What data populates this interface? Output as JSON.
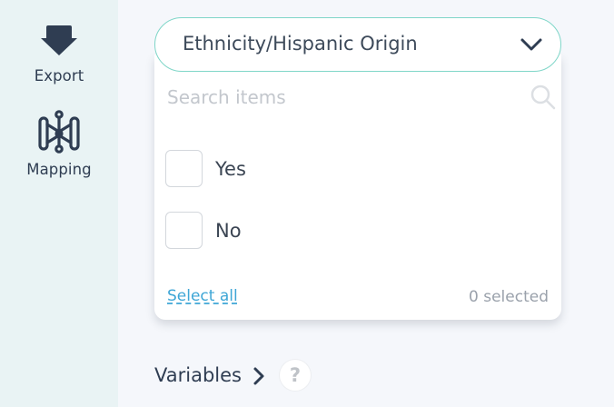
{
  "sidebar": {
    "export": {
      "label": "Export",
      "icon": "download-arrow-icon"
    },
    "mapping": {
      "label": "Mapping",
      "icon": "mapping-icon"
    }
  },
  "filter": {
    "selected_value": "Ethnicity/Hispanic Origin",
    "search_placeholder": "Search items",
    "search_value": "",
    "options": [
      {
        "label": "Yes",
        "checked": false
      },
      {
        "label": "No",
        "checked": false
      }
    ],
    "select_all_label": "Select all",
    "selected_count": "0 selected"
  },
  "variables": {
    "label": "Variables",
    "help_glyph": "?"
  },
  "colors": {
    "sidebar_bg": "#e9f3f4",
    "main_bg": "#f5f7fb",
    "accent_border": "#7fd6c8",
    "link": "#3ea6d6",
    "icon_dark": "#2f3d52"
  }
}
